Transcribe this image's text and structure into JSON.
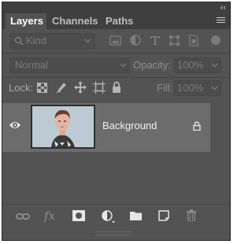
{
  "panel": {
    "collapse_glyph": "‹‹",
    "tabs": [
      {
        "label": "Layers",
        "active": true
      },
      {
        "label": "Channels",
        "active": false
      },
      {
        "label": "Paths",
        "active": false
      }
    ]
  },
  "filter": {
    "kind_placeholder": "Kind",
    "filter_icons": [
      "image-filter-icon",
      "adjustment-filter-icon",
      "type-filter-icon",
      "shape-filter-icon",
      "smart-object-filter-icon"
    ]
  },
  "blend": {
    "mode": "Normal",
    "opacity_label": "Opacity:",
    "opacity_value": "100%"
  },
  "lock": {
    "label": "Lock:",
    "icons": [
      "lock-transparent-pixels-icon",
      "lock-image-pixels-icon",
      "lock-position-icon",
      "lock-artboard-icon",
      "lock-all-icon"
    ],
    "fill_label": "Fill:",
    "fill_value": "100%"
  },
  "layers": [
    {
      "name": "Background",
      "visible": true,
      "locked": true
    }
  ],
  "bottom_toolbar": {
    "fx_label": "fx",
    "icons": [
      "link-layers-icon",
      "layer-style-icon",
      "add-mask-icon",
      "new-adjustment-layer-icon",
      "new-group-icon",
      "new-layer-icon",
      "delete-layer-icon"
    ]
  },
  "colors": {
    "panel_bg": "#535353",
    "tab_bar_bg": "#3f3f3f",
    "selected_layer_bg": "#6c6c6c"
  }
}
